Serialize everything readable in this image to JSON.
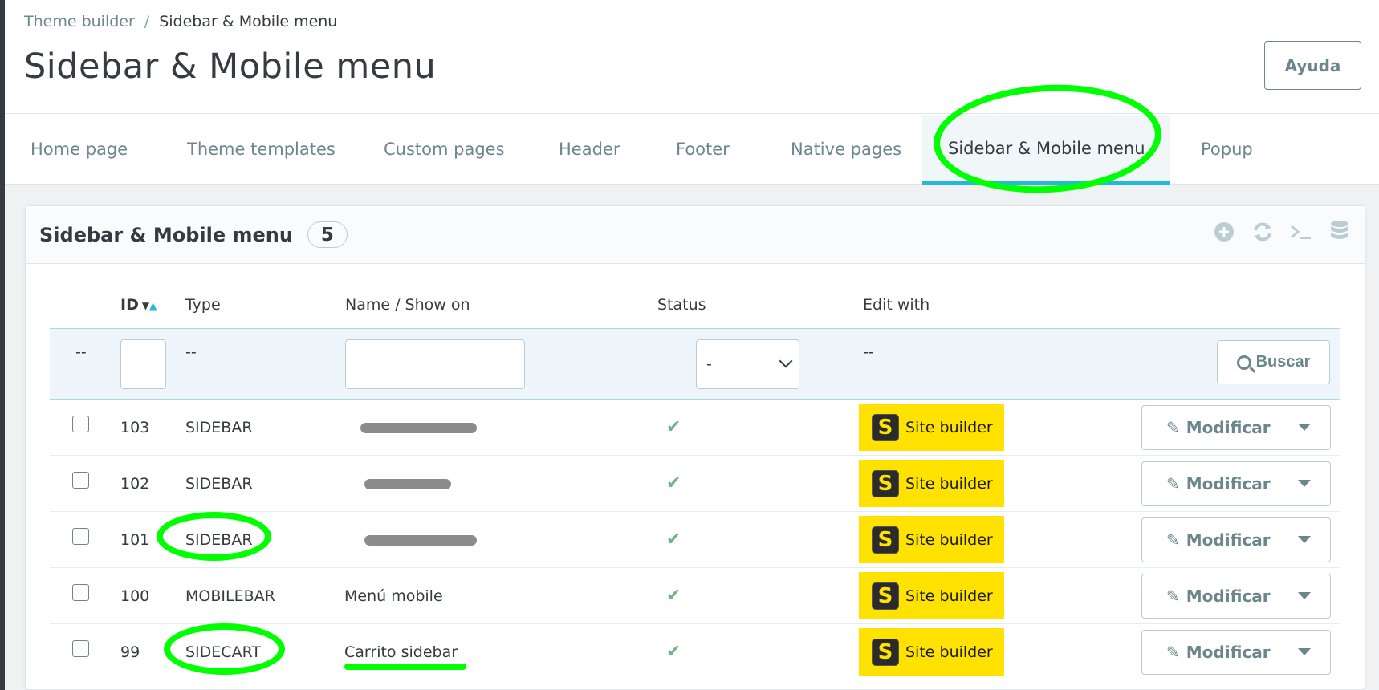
{
  "breadcrumb": {
    "parent": "Theme builder",
    "separator": "/",
    "current": "Sidebar & Mobile menu"
  },
  "page": {
    "title": "Sidebar & Mobile menu",
    "help_label": "Ayuda"
  },
  "tabs": [
    {
      "label": "Home page",
      "active": false
    },
    {
      "label": "Theme templates",
      "active": false
    },
    {
      "label": "Custom pages",
      "active": false
    },
    {
      "label": "Header",
      "active": false
    },
    {
      "label": "Footer",
      "active": false
    },
    {
      "label": "Native pages",
      "active": false
    },
    {
      "label": "Sidebar & Mobile menu",
      "active": true
    },
    {
      "label": "Popup",
      "active": false
    }
  ],
  "panel": {
    "title": "Sidebar & Mobile menu",
    "count": "5",
    "actions": [
      "add-icon",
      "refresh-icon",
      "sql-terminal-icon",
      "database-icon"
    ]
  },
  "table": {
    "columns": {
      "id": "ID",
      "type": "Type",
      "name": "Name / Show on",
      "status": "Status",
      "edit_with": "Edit with"
    },
    "filters": {
      "empty": "--",
      "status_value": "-",
      "search_label": "Buscar"
    },
    "rows": [
      {
        "id": "103",
        "type": "SIDEBAR",
        "name": "",
        "status": "✔",
        "editor": "Site builder",
        "action": "Modificar"
      },
      {
        "id": "102",
        "type": "SIDEBAR",
        "name": "",
        "status": "✔",
        "editor": "Site builder",
        "action": "Modificar"
      },
      {
        "id": "101",
        "type": "SIDEBAR",
        "name": "",
        "status": "✔",
        "editor": "Site builder",
        "action": "Modificar"
      },
      {
        "id": "100",
        "type": "MOBILEBAR",
        "name": "Menú mobile",
        "status": "✔",
        "editor": "Site builder",
        "action": "Modificar"
      },
      {
        "id": "99",
        "type": "SIDECART",
        "name": "Carrito sidebar",
        "status": "✔",
        "editor": "Site builder",
        "action": "Modificar"
      }
    ]
  },
  "colors": {
    "accent": "#25b9d7",
    "site_builder_badge": "#ffe200",
    "status_ok": "#70b580",
    "annotation": "#00ff00"
  }
}
